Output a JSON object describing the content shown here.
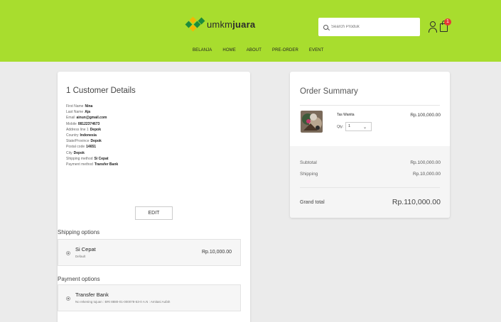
{
  "colors": {
    "header": "#a8dd2e",
    "badge": "#e53935",
    "page_bg": "#ebebeb"
  },
  "header": {
    "logo_prefix": "umkm",
    "logo_bold": "juara",
    "search_placeholder": "Search Produk",
    "cart_count": "1",
    "nav": [
      "BELANJA",
      "HOME",
      "ABOUT",
      "PRE-ORDER",
      "EVENT"
    ]
  },
  "customer": {
    "title": "1 Customer Details",
    "fields": [
      {
        "label": "First Name",
        "value": "Nina"
      },
      {
        "label": "Last Name",
        "value": "Aja"
      },
      {
        "label": "Email",
        "value": "ainun@gmail.com"
      },
      {
        "label": "Mobile",
        "value": "08122374673"
      },
      {
        "label": "Address line 1",
        "value": "Depok"
      },
      {
        "label": "Country",
        "value": "Indonesia"
      },
      {
        "label": "State/Province",
        "value": "Depok"
      },
      {
        "label": "Postal code",
        "value": "14651"
      },
      {
        "label": "City",
        "value": "Depok"
      },
      {
        "label": "Shipping method",
        "value": "Si Cepat"
      },
      {
        "label": "Payment method",
        "value": "Transfer Bank"
      }
    ],
    "edit_label": "EDIT"
  },
  "shipping": {
    "title": "Shipping options",
    "name": "Si Cepat",
    "sub": "Default",
    "price": "Rp.10,000.00"
  },
  "payment": {
    "title": "Payment options",
    "name": "Transfer Bank",
    "sub": "No rekening tujuan : BRI 8880-01-000078-53-0 A.N : Amitasi Aufah"
  },
  "summary": {
    "title": "Order Summary",
    "item_name": "Tas Wanita",
    "qty_label": "Qty:",
    "qty_value": "1",
    "item_price": "Rp.100,000.00",
    "subtotal_label": "Subtotal",
    "subtotal_value": "Rp.100,000.00",
    "shipping_label": "Shipping",
    "shipping_value": "Rp.10,000.00",
    "grand_label": "Grand total",
    "grand_value": "Rp.110,000.00"
  }
}
